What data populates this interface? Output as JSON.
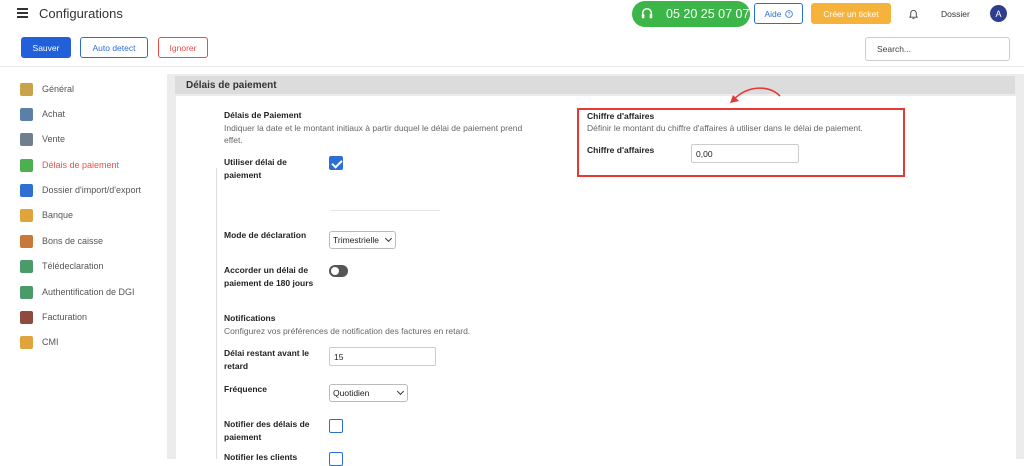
{
  "header": {
    "title": "Configurations",
    "phone": "05 20 25 07 07",
    "help_label": "Aide",
    "ticket_label": "Créer un ticket",
    "dossier_label": "Dossier",
    "avatar_initial": "A"
  },
  "toolbar": {
    "save_label": "Sauver",
    "auto_detect_label": "Auto detect",
    "ignore_label": "Ignorer",
    "search_placeholder": "Search..."
  },
  "sidebar": {
    "items": [
      {
        "label": "Général",
        "icon": "gear-icon",
        "color": "#c9a24a"
      },
      {
        "label": "Achat",
        "icon": "cash-register-icon",
        "color": "#5b7fa6"
      },
      {
        "label": "Vente",
        "icon": "chart-icon",
        "color": "#6f7f8f"
      },
      {
        "label": "Délais de paiement",
        "icon": "calculator-icon",
        "color": "#4caf50"
      },
      {
        "label": "Dossier d'import/d'export",
        "icon": "folder-icon",
        "color": "#2e6fd1"
      },
      {
        "label": "Banque",
        "icon": "bank-icon",
        "color": "#e0a43c"
      },
      {
        "label": "Bons de caisse",
        "icon": "receipt-icon",
        "color": "#c7793a"
      },
      {
        "label": "Télédeclaration",
        "icon": "document-icon",
        "color": "#4a9a6a"
      },
      {
        "label": "Authentification de DGI",
        "icon": "calculator-icon",
        "color": "#4a9a6a"
      },
      {
        "label": "Facturation",
        "icon": "tag-icon",
        "color": "#8e4a3f"
      },
      {
        "label": "CMI",
        "icon": "cmi-icon",
        "color": "#e0a43c"
      }
    ],
    "active_index": 3
  },
  "main": {
    "section_title": "Délais de paiement",
    "delais_title": "Délais de Paiement",
    "delais_desc": "Indiquer la date et le montant initiaux à partir duquel le délai de paiement prend effet.",
    "utiliser_label": "Utiliser délai de paiement",
    "utiliser_checked": true,
    "mode_label": "Mode de déclaration",
    "mode_value": "Trimestrielle",
    "accorder_label": "Accorder un délai de paiement de 180 jours",
    "accorder_on": false,
    "notifications_title": "Notifications",
    "notifications_desc": "Configurez vos préférences de notification des factures en retard.",
    "delai_restant_label": "Délai restant avant le retard",
    "delai_restant_value": "15",
    "frequence_label": "Fréquence",
    "frequence_value": "Quotidien",
    "notifier_label": "Notifier des délais de paiement",
    "notifier_checked": false,
    "notifier_clients_label": "Notifier les clients"
  },
  "chiffre": {
    "title": "Chiffre d'affaires",
    "desc": "Définir le montant du chiffre d'affaires à utiliser dans le délai de paiement.",
    "field_label": "Chiffre d'affaires",
    "field_value": "0,00"
  }
}
